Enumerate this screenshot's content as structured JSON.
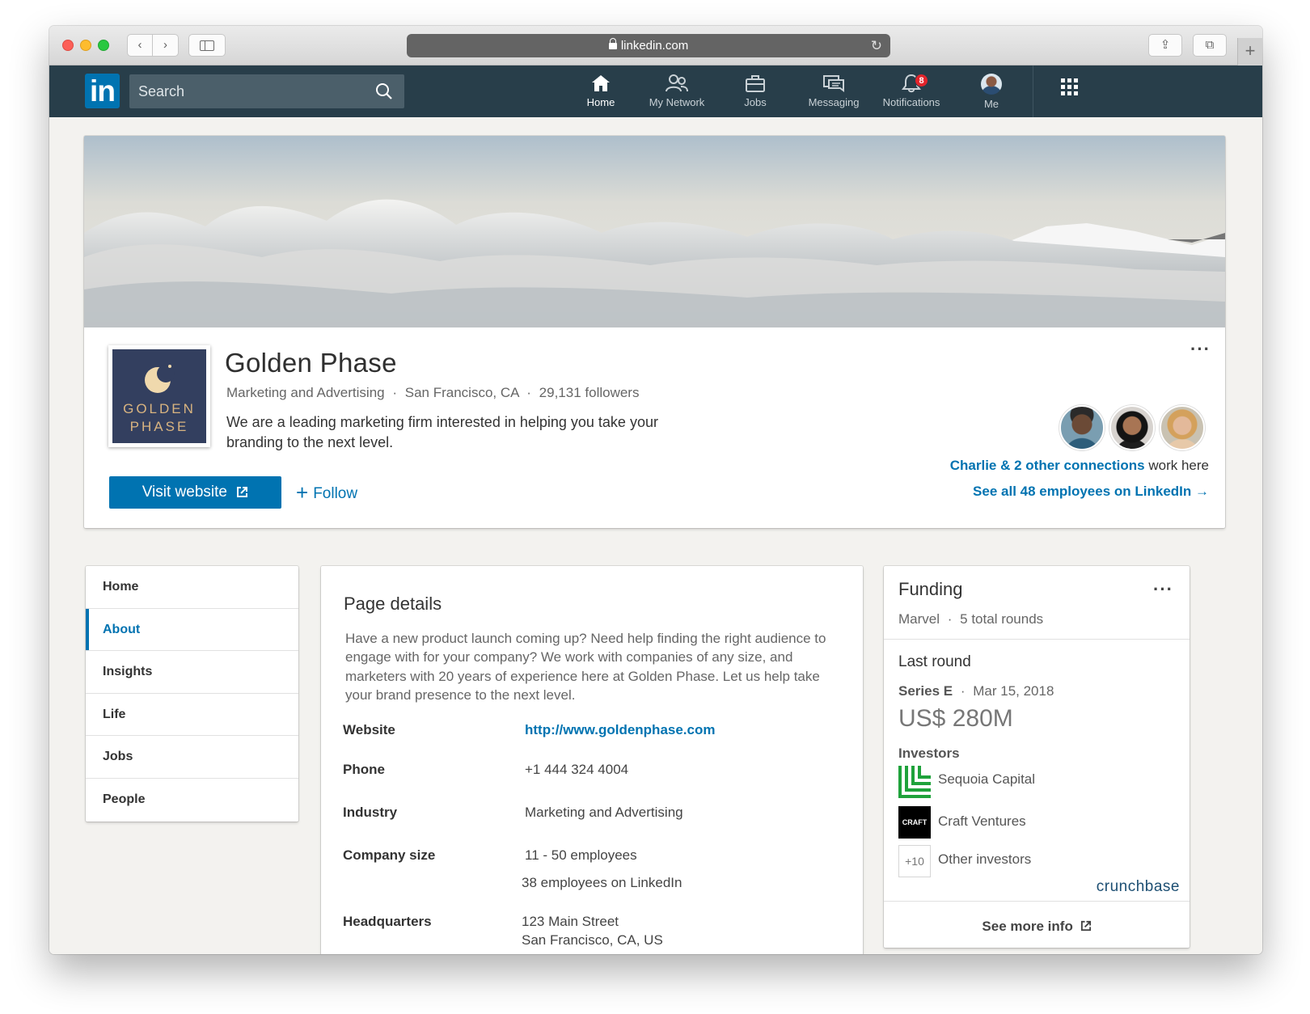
{
  "browser": {
    "url": "linkedin.com",
    "back_glyph": "‹",
    "forward_glyph": "›",
    "share_glyph": "⇪",
    "tabs_glyph": "⧉",
    "plus_glyph": "+",
    "reload_glyph": "↻"
  },
  "nav": {
    "logo": "in",
    "search_placeholder": "Search",
    "items": [
      {
        "label": "Home",
        "icon": "home-icon"
      },
      {
        "label": "My Network",
        "icon": "network-icon"
      },
      {
        "label": "Jobs",
        "icon": "briefcase-icon"
      },
      {
        "label": "Messaging",
        "icon": "messaging-icon"
      },
      {
        "label": "Notifications",
        "icon": "bell-icon",
        "badge": "8"
      },
      {
        "label": "Me",
        "icon": "avatar"
      }
    ]
  },
  "company": {
    "name": "Golden Phase",
    "logo_line1": "GOLDEN",
    "logo_line2": "PHASE",
    "industry": "Marketing and Advertising",
    "location": "San Francisco, CA",
    "followers": "29,131 followers",
    "separator": "·",
    "description": "We are a leading marketing firm interested in helping you take your branding to the next level.",
    "visit_label": "Visit website",
    "follow_label": "Follow",
    "follow_plus": "+",
    "more_label": "···",
    "connections_link": "Charlie & 2 other connections",
    "connections_suffix": " work here",
    "see_all": "See all 48 employees on LinkedIn",
    "see_all_arrow": "→"
  },
  "leftnav": {
    "items": [
      "Home",
      "About",
      "Insights",
      "Life",
      "Jobs",
      "People"
    ],
    "active_index": 1
  },
  "details": {
    "title": "Page details",
    "about": "Have a new product launch coming up? Need help finding the right audience to engage with for your company? We work with companies of any size, and marketers with 20 years of experience here at Golden Phase. Let us help take your brand presence to the next level.",
    "website_label": "Website",
    "website_value": "http://www.goldenphase.com",
    "phone_label": "Phone",
    "phone_value": "+1 444 324 4004",
    "industry_label": "Industry",
    "industry_value": "Marketing and Advertising",
    "size_label": "Company size",
    "size_value": "11 - 50 employees",
    "size_linkedin": "38 employees on LinkedIn",
    "hq_label": "Headquarters",
    "hq_line1": "123 Main Street",
    "hq_line2": "San Francisco, CA, US"
  },
  "funding": {
    "title": "Funding",
    "more_label": "···",
    "source": "Marvel",
    "rounds": "5 total rounds",
    "separator": "·",
    "last_round_label": "Last round",
    "series": "Series E",
    "date": "Mar 15, 2018",
    "amount": "US$ 280M",
    "investors_label": "Investors",
    "investors": [
      {
        "name": "Sequoia Capital",
        "logo": "sequoia-logo"
      },
      {
        "name": "Craft Ventures",
        "logo": "craft-logo",
        "logo_text": "CRAFT"
      },
      {
        "name": "Other investors",
        "logo": "more-investors-badge",
        "logo_text": "+10"
      }
    ],
    "brand": "crunchbase",
    "see_more": "See more info"
  },
  "colors": {
    "accent": "#0073b1",
    "nav_bg": "#283e4a",
    "badge": "#e3242b",
    "page_bg": "#f3f2ef"
  }
}
